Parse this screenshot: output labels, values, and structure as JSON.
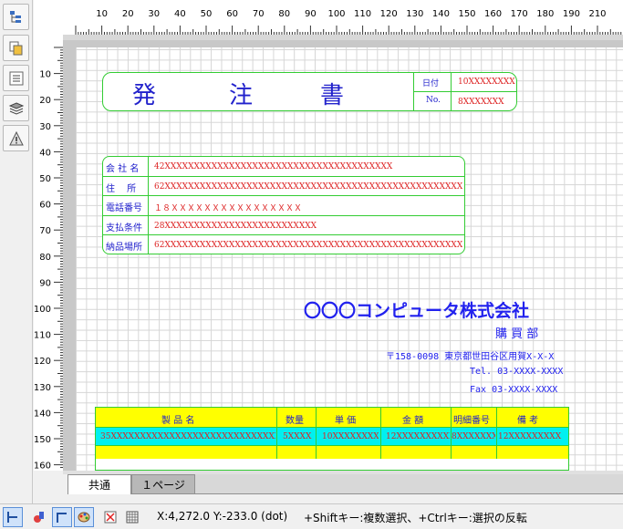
{
  "toolbar": {
    "icons": [
      "tree-icon",
      "copy-icon",
      "list-icon",
      "layers-icon",
      "warning-icon"
    ]
  },
  "ruler": {
    "h_labels": [
      "10",
      "20",
      "30",
      "40",
      "50",
      "60",
      "70",
      "80",
      "90",
      "100",
      "110",
      "120",
      "130",
      "140",
      "150",
      "160",
      "170",
      "180",
      "190",
      "210"
    ],
    "v_labels": [
      "10",
      "20",
      "30",
      "40",
      "50",
      "60",
      "70",
      "80",
      "90",
      "100",
      "110",
      "120",
      "130",
      "140",
      "150",
      "160"
    ]
  },
  "doc": {
    "title_chars": [
      "発",
      "注",
      "書"
    ],
    "date_label": "日付",
    "date_value": "10XXXXXXXX",
    "no_label": "No.",
    "no_value": "8XXXXXXX",
    "fields": [
      {
        "label": "会 社 名",
        "value": "42XXXXXXXXXXXXXXXXXXXXXXXXXXXXXXXXXXXXXXX"
      },
      {
        "label": "住　 所",
        "value": "62XXXXXXXXXXXXXXXXXXXXXXXXXXXXXXXXXXXXXXXXXXXXXXXXXXXXXXXXXXXX"
      },
      {
        "label": "電話番号",
        "value": "１８ＸＸＸＸＸＸＸＸＸＸＸＸＸＸＸＸ"
      },
      {
        "label": "支払条件",
        "value": "28XXXXXXXXXXXXXXXXXXXXXXXXXX"
      },
      {
        "label": "納品場所",
        "value": "62XXXXXXXXXXXXXXXXXXXXXXXXXXXXXXXXXXXXXXXXXXXXXXXXXXXXXXXXXXXX"
      }
    ],
    "company": "〇〇〇コンピュータ株式会社",
    "dept": "購 買 部",
    "address": "〒158-0098 東京都世田谷区用賀X-X-X",
    "tel": "Tel. 03-XXXX-XXXX",
    "fax": "Fax 03-XXXX-XXXX",
    "table_headers": [
      "製 品 名",
      "数量",
      "単 価",
      "金 額",
      "明細番号",
      "備 考"
    ],
    "table_row": [
      "35XXXXXXXXXXXXXXXXXXXXXXXXXXXXXXXXX",
      "5XXXX",
      "10XXXXXXXX",
      "12XXXXXXXXXX",
      "8XXXXXXX",
      "12XXXXXXXXX"
    ]
  },
  "tabs": {
    "common": "共通",
    "page1": "１ページ"
  },
  "status": {
    "coords": "X:4,272.0 Y:-233.0 (dot)",
    "hint": "+Shiftキー:複数選択、+Ctrlキー:選択の反転"
  }
}
